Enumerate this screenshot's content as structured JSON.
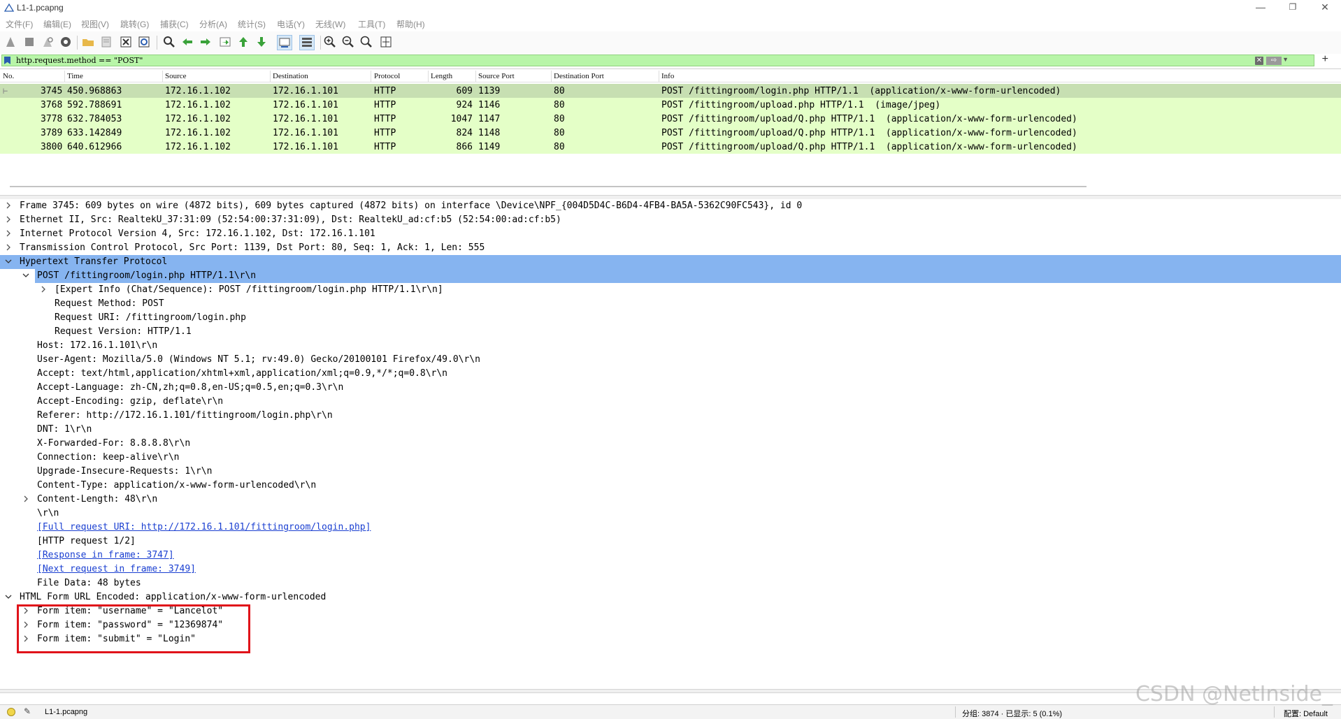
{
  "window": {
    "title": "L1-1.pcapng"
  },
  "menu": [
    "文件(F)",
    "编辑(E)",
    "视图(V)",
    "跳转(G)",
    "捕获(C)",
    "分析(A)",
    "统计(S)",
    "电话(Y)",
    "无线(W)",
    "工具(T)",
    "帮助(H)"
  ],
  "toolbar": {
    "icons": [
      "shark-fin-start-icon",
      "stop-capture-icon",
      "restart-capture-icon",
      "capture-options-icon",
      "open-file-icon",
      "save-file-icon",
      "close-file-icon",
      "reload-file-icon",
      "find-packet-icon",
      "go-back-icon",
      "go-forward-icon",
      "go-to-packet-icon",
      "go-first-packet-icon",
      "go-last-packet-icon",
      "auto-scroll-icon",
      "colorize-icon",
      "zoom-in-icon",
      "zoom-out-icon",
      "zoom-normal-icon",
      "resize-columns-icon"
    ]
  },
  "filter": {
    "value": "http.request.method == \"POST\"",
    "accent": "#b8f5a8"
  },
  "packet_list": {
    "columns": [
      "No.",
      "Time",
      "Source",
      "Destination",
      "Protocol",
      "Length",
      "Source Port",
      "Destination Port",
      "Info"
    ],
    "rows": [
      {
        "no": "3745",
        "time": "450.968863",
        "src": "172.16.1.102",
        "dst": "172.16.1.101",
        "proto": "HTTP",
        "len": "609",
        "sport": "1139",
        "dport": "80",
        "info": "POST /fittingroom/login.php HTTP/1.1  (application/x-www-form-urlencoded)"
      },
      {
        "no": "3768",
        "time": "592.788691",
        "src": "172.16.1.102",
        "dst": "172.16.1.101",
        "proto": "HTTP",
        "len": "924",
        "sport": "1146",
        "dport": "80",
        "info": "POST /fittingroom/upload.php HTTP/1.1  (image/jpeg)"
      },
      {
        "no": "3778",
        "time": "632.784053",
        "src": "172.16.1.102",
        "dst": "172.16.1.101",
        "proto": "HTTP",
        "len": "1047",
        "sport": "1147",
        "dport": "80",
        "info": "POST /fittingroom/upload/Q.php HTTP/1.1  (application/x-www-form-urlencoded)"
      },
      {
        "no": "3789",
        "time": "633.142849",
        "src": "172.16.1.102",
        "dst": "172.16.1.101",
        "proto": "HTTP",
        "len": "824",
        "sport": "1148",
        "dport": "80",
        "info": "POST /fittingroom/upload/Q.php HTTP/1.1  (application/x-www-form-urlencoded)"
      },
      {
        "no": "3800",
        "time": "640.612966",
        "src": "172.16.1.102",
        "dst": "172.16.1.101",
        "proto": "HTTP",
        "len": "866",
        "sport": "1149",
        "dport": "80",
        "info": "POST /fittingroom/upload/Q.php HTTP/1.1  (application/x-www-form-urlencoded)"
      }
    ]
  },
  "details": {
    "rows": [
      {
        "text": "Frame 3745: 609 bytes on wire (4872 bits), 609 bytes captured (4872 bits) on interface \\Device\\NPF_{004D5D4C-B6D4-4FB4-BA5A-5362C90FC543}, id 0",
        "arrow": "right"
      },
      {
        "text": "Ethernet II, Src: RealtekU_37:31:09 (52:54:00:37:31:09), Dst: RealtekU_ad:cf:b5 (52:54:00:ad:cf:b5)",
        "arrow": "right"
      },
      {
        "text": "Internet Protocol Version 4, Src: 172.16.1.102, Dst: 172.16.1.101",
        "arrow": "right"
      },
      {
        "text": "Transmission Control Protocol, Src Port: 1139, Dst Port: 80, Seq: 1, Ack: 1, Len: 555",
        "arrow": "right"
      },
      {
        "text": "Hypertext Transfer Protocol",
        "arrow": "down",
        "highlight": true
      },
      {
        "text": "POST /fittingroom/login.php HTTP/1.1\\r\\n",
        "arrow": "down",
        "highlight": true,
        "indent": 1
      },
      {
        "text": "[Expert Info (Chat/Sequence): POST /fittingroom/login.php HTTP/1.1\\r\\n]",
        "arrow": "right",
        "indent": 2
      },
      {
        "text": "Request Method: POST",
        "indent": 2
      },
      {
        "text": "Request URI: /fittingroom/login.php",
        "indent": 2
      },
      {
        "text": "Request Version: HTTP/1.1",
        "indent": 2
      },
      {
        "text": "Host: 172.16.1.101\\r\\n",
        "indent": 1
      },
      {
        "text": "User-Agent: Mozilla/5.0 (Windows NT 5.1; rv:49.0) Gecko/20100101 Firefox/49.0\\r\\n",
        "indent": 1
      },
      {
        "text": "Accept: text/html,application/xhtml+xml,application/xml;q=0.9,*/*;q=0.8\\r\\n",
        "indent": 1
      },
      {
        "text": "Accept-Language: zh-CN,zh;q=0.8,en-US;q=0.5,en;q=0.3\\r\\n",
        "indent": 1
      },
      {
        "text": "Accept-Encoding: gzip, deflate\\r\\n",
        "indent": 1
      },
      {
        "text": "Referer: http://172.16.1.101/fittingroom/login.php\\r\\n",
        "indent": 1
      },
      {
        "text": "DNT: 1\\r\\n",
        "indent": 1
      },
      {
        "text": "X-Forwarded-For: 8.8.8.8\\r\\n",
        "indent": 1
      },
      {
        "text": "Connection: keep-alive\\r\\n",
        "indent": 1
      },
      {
        "text": "Upgrade-Insecure-Requests: 1\\r\\n",
        "indent": 1
      },
      {
        "text": "Content-Type: application/x-www-form-urlencoded\\r\\n",
        "indent": 1
      },
      {
        "text": "Content-Length: 48\\r\\n",
        "arrow": "right",
        "indent": 1
      },
      {
        "text": "\\r\\n",
        "indent": 1
      },
      {
        "text": "[Full request URI: http://172.16.1.101/fittingroom/login.php]",
        "indent": 1,
        "link": true
      },
      {
        "text": "[HTTP request 1/2]",
        "indent": 1
      },
      {
        "text": "[Response in frame: 3747]",
        "indent": 1,
        "link": true
      },
      {
        "text": "[Next request in frame: 3749]",
        "indent": 1,
        "link": true
      },
      {
        "text": "File Data: 48 bytes",
        "indent": 1
      },
      {
        "text": "HTML Form URL Encoded: application/x-www-form-urlencoded",
        "arrow": "down"
      },
      {
        "text": "Form item: \"username\" = \"Lancelot\"",
        "arrow": "right",
        "indent": 1
      },
      {
        "text": "Form item: \"password\" = \"12369874\"",
        "arrow": "right",
        "indent": 1
      },
      {
        "text": "Form item: \"submit\" = \"Login\"",
        "arrow": "right",
        "indent": 1
      }
    ]
  },
  "status": {
    "file": "L1-1.pcapng",
    "packets": "分组: 3874 · 已显示: 5 (0.1%)",
    "profile": "配置: Default"
  },
  "watermark": "CSDN @NetInside_"
}
